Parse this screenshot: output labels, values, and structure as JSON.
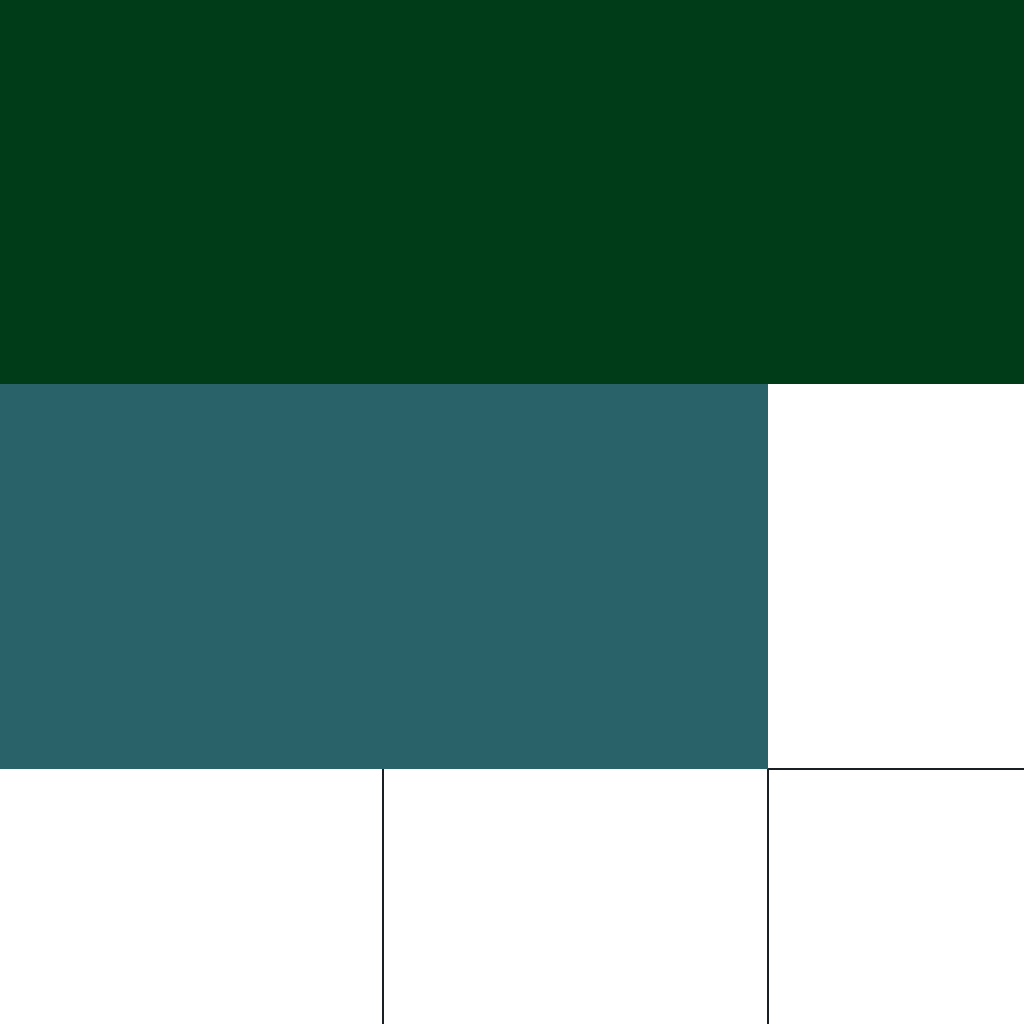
{
  "colors": {
    "top_band": "#003c18",
    "middle_band": "#296268",
    "background": "#ffffff",
    "grid_line": "#1a1f24"
  }
}
